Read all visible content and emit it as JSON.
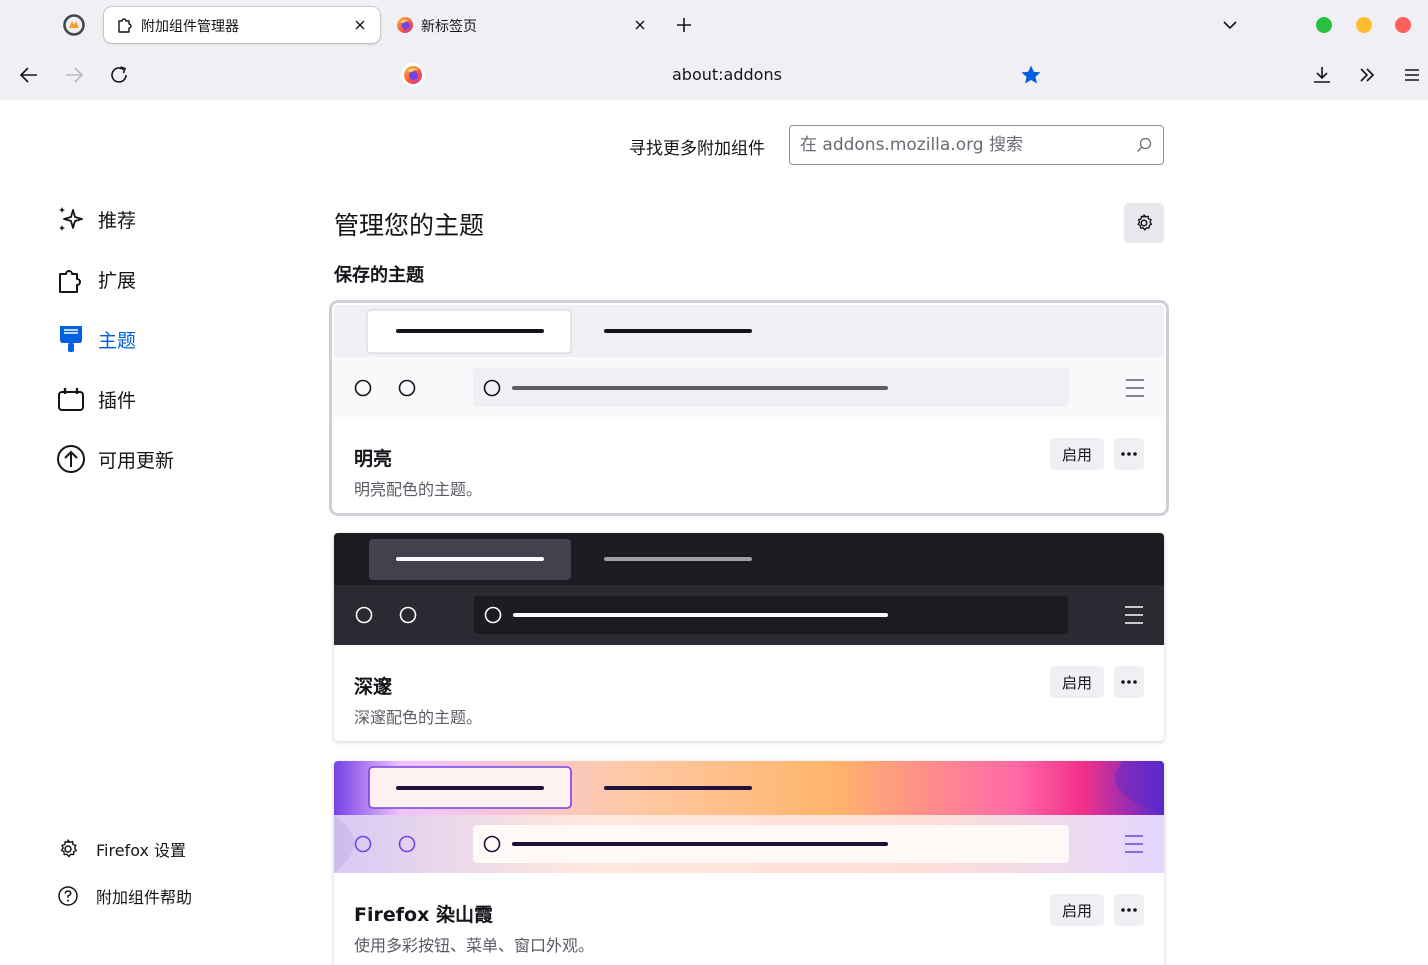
{
  "browser": {
    "tabs": [
      {
        "title": "附加组件管理器",
        "active": true,
        "icon": "puzzle-icon"
      },
      {
        "title": "新标签页",
        "active": false,
        "icon": "firefox-logo-icon"
      }
    ],
    "url": "about:addons",
    "window_controls": {
      "green": "#2ac042",
      "yellow": "#fdbc2e",
      "red": "#fe5f58"
    }
  },
  "header": {
    "find_more_label": "寻找更多附加组件",
    "search_placeholder": "在 addons.mozilla.org 搜索"
  },
  "sidebar": {
    "categories": [
      {
        "label": "推荐",
        "icon": "sparkle-icon",
        "selected": false
      },
      {
        "label": "扩展",
        "icon": "puzzle-icon",
        "selected": false
      },
      {
        "label": "主题",
        "icon": "brush-icon",
        "selected": true
      },
      {
        "label": "插件",
        "icon": "plugin-icon",
        "selected": false
      },
      {
        "label": "可用更新",
        "icon": "arrow-up-circle-icon",
        "selected": false
      }
    ],
    "footer": [
      {
        "label": "Firefox 设置",
        "icon": "gear-icon"
      },
      {
        "label": "附加组件帮助",
        "icon": "help-circle-icon"
      }
    ]
  },
  "main": {
    "heading": "管理您的主题",
    "section_heading": "保存的主题",
    "themes": [
      {
        "name": "明亮",
        "description": "明亮配色的主题。",
        "enable_label": "启用",
        "preview": "light"
      },
      {
        "name": "深邃",
        "description": "深邃配色的主题。",
        "enable_label": "启用",
        "preview": "dark"
      },
      {
        "name": "Firefox 染山霞",
        "description": "使用多彩按钮、菜单、窗口外观。",
        "enable_label": "启用",
        "preview": "alpenglow"
      }
    ]
  },
  "colors": {
    "accent": "#0061e0",
    "chrome_bg": "#f0f0f4",
    "text": "#15141a",
    "secondary_text": "#5b5b66"
  }
}
